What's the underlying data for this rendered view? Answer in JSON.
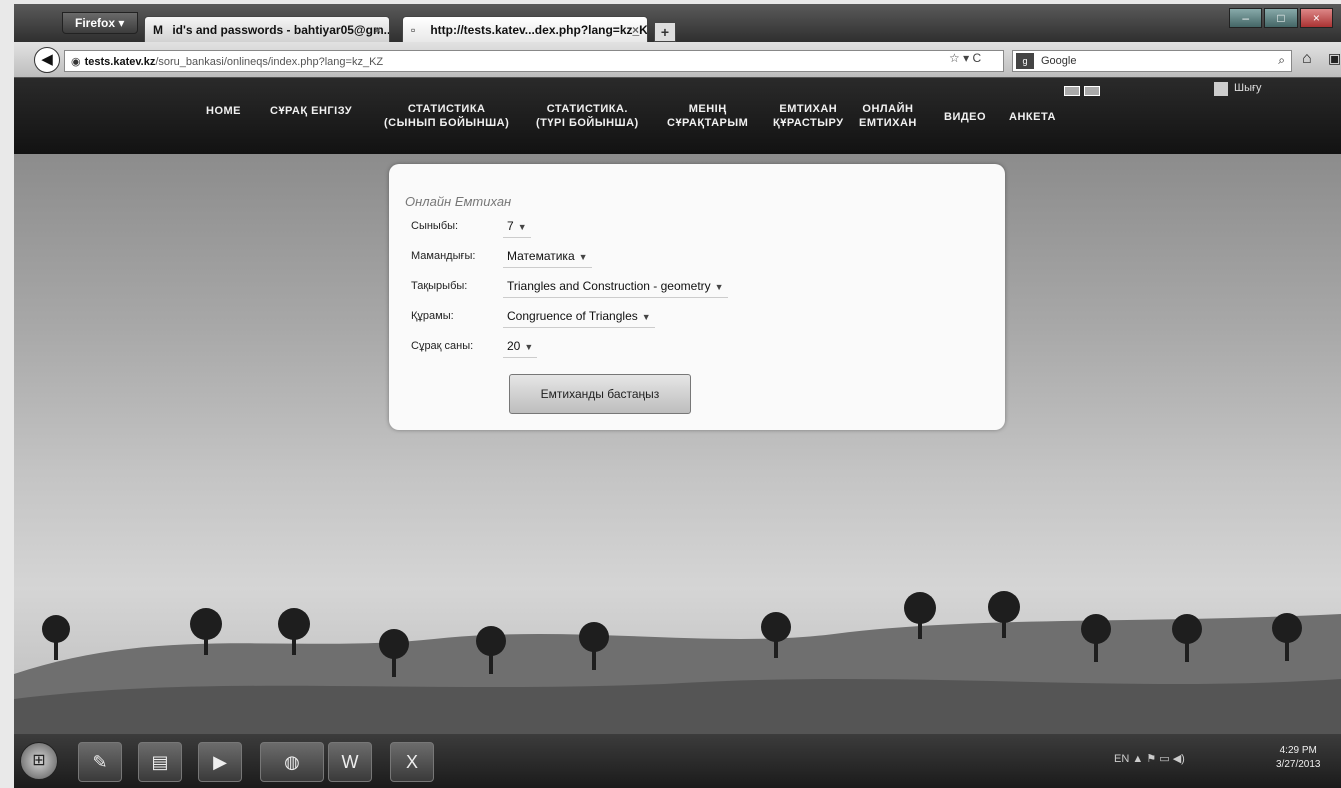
{
  "browser": {
    "menu_label": "Firefox ▾",
    "tabs": [
      {
        "label": "id's and passwords - bahtiyar05@gm...",
        "icon": "gmail-icon"
      },
      {
        "label": "http://tests.katev...dex.php?lang=kz_KZ",
        "icon": "page-icon"
      }
    ],
    "url_domain": "tests.katev.kz",
    "url_path": "/soru_bankasi/onlineqs/index.php?lang=kz_KZ",
    "search_placeholder": "Google"
  },
  "site_menu": [
    {
      "label": "HOME"
    },
    {
      "label": "СҰРАҚ ЕНГІЗУ"
    },
    {
      "label": "СТАТИСТИКА\n(СЫНЫП БОЙЫНША)"
    },
    {
      "label": "СТАТИСТИКА.\n(ТҮРІ БОЙЫНША)"
    },
    {
      "label": "МЕНІҢ\nСҰРАҚТАРЫМ"
    },
    {
      "label": "ЕМТИХАН\nҚҰРАСТЫРУ"
    },
    {
      "label": "ОНЛАЙН\nЕМТИХАН"
    },
    {
      "label": "ВИДЕО"
    },
    {
      "label": "АНКЕТА"
    }
  ],
  "header_right": {
    "exit_label": "Шығу"
  },
  "exam_form": {
    "title": "Онлайн Емтихан",
    "fields": [
      {
        "label": "Сыныбы:",
        "value": "7"
      },
      {
        "label": "Мамандығы:",
        "value": "Математика"
      },
      {
        "label": "Тақырыбы:",
        "value": "Triangles and Construction - geometry"
      },
      {
        "label": "Құрамы:",
        "value": "Congruence of Triangles"
      },
      {
        "label": "Сұрақ саны:",
        "value": "20"
      }
    ],
    "start_button": "Емтиханды бастаңыз"
  },
  "taskbar": {
    "language": "EN",
    "time": "4:29 PM",
    "date": "3/27/2013",
    "apps": [
      "start-orb",
      "pen-app-icon",
      "explorer-icon",
      "media-player-icon",
      "firefox-icon",
      "word-icon",
      "excel-icon"
    ]
  }
}
